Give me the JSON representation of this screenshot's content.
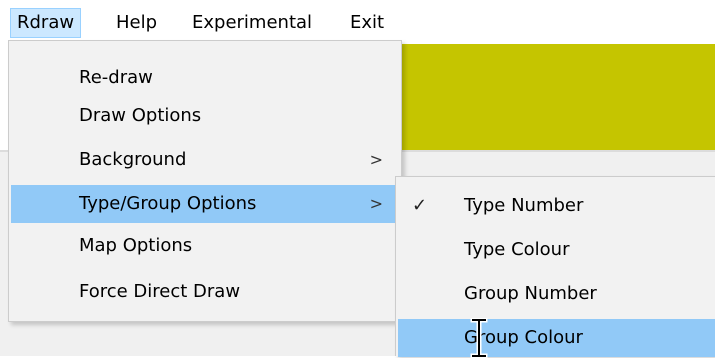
{
  "colors": {
    "accent_yellow": "#c5c500",
    "highlight": "#91c9f7",
    "menubar_active": "#cce8ff",
    "menu_background": "#f2f2f2"
  },
  "menubar": {
    "items": [
      {
        "label": "Rdraw"
      },
      {
        "label": "Help"
      },
      {
        "label": "Experimental"
      },
      {
        "label": "Exit"
      }
    ]
  },
  "rdraw_menu": {
    "items": [
      {
        "label": "Re-draw"
      },
      {
        "label": "Draw Options"
      },
      {
        "label": "Background",
        "submenu_arrow": ">"
      },
      {
        "label": "Type/Group Options",
        "submenu_arrow": ">"
      },
      {
        "label": "Map Options"
      },
      {
        "label": "Force Direct Draw"
      }
    ]
  },
  "type_group_submenu": {
    "checkmark": "✓",
    "items": [
      {
        "label": "Type Number"
      },
      {
        "label": "Type Colour"
      },
      {
        "label": "Group Number"
      },
      {
        "label": "Group Colour"
      }
    ]
  },
  "icons": [
    "checkmark-icon",
    "chevron-right-icon",
    "text-cursor-icon"
  ]
}
